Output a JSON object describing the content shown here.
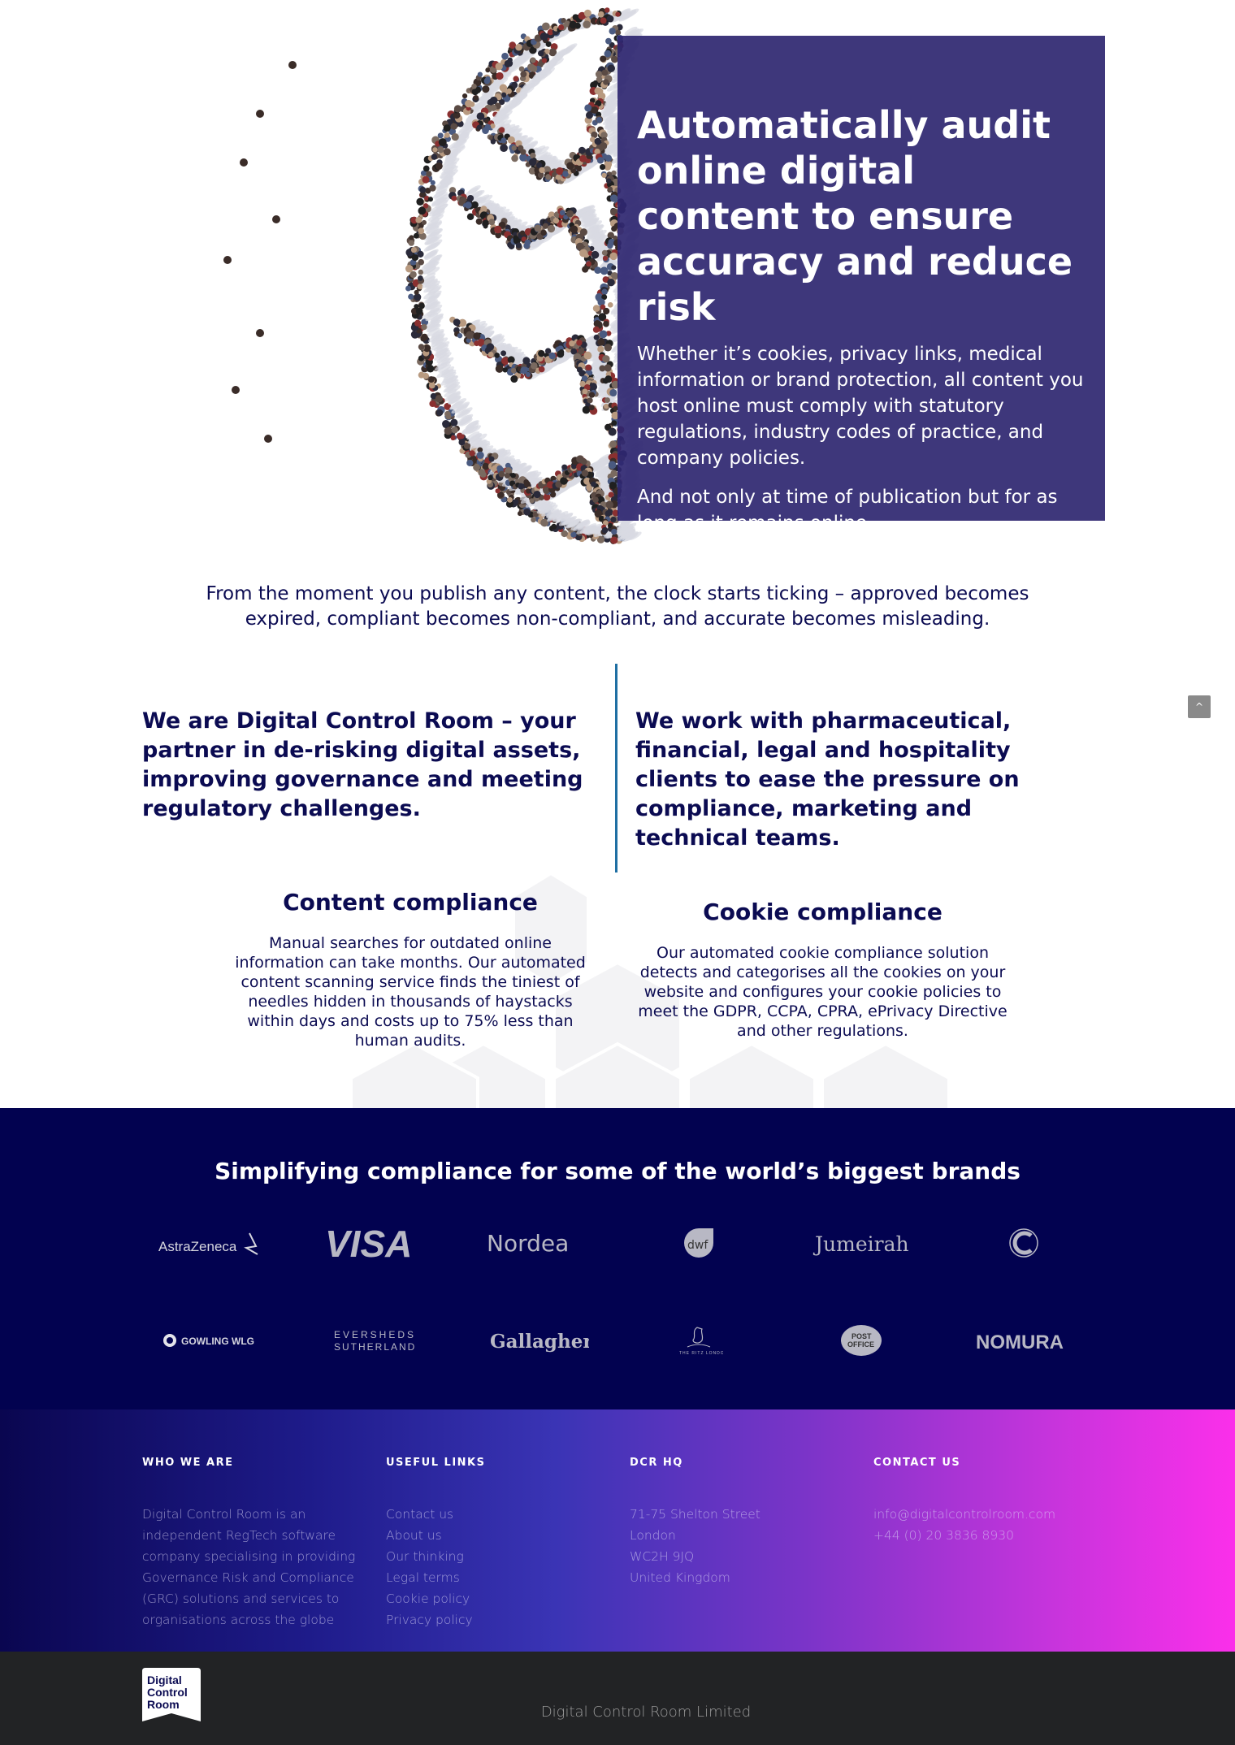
{
  "hero": {
    "title": "Automatically audit online digital content to ensure accuracy and reduce risk",
    "paragraph_1": "Whether it’s cookies, privacy links, medical information or brand protection, all content you host online must comply with statutory regulations, industry codes of practice, and company policies.",
    "paragraph_2": "And not only at time of publication but for as long as it remains online.",
    "image_alt": "Crowd of people forming a brain shape"
  },
  "intro": {
    "line_1": "From the moment you publish any content, the clock starts ticking – approved becomes",
    "line_2": "expired, compliant becomes non-compliant, and accurate becomes misleading."
  },
  "about": {
    "left": "We are Digital Control Room – your partner in de-risking digital assets, improving governance and meeting regulatory challenges.",
    "right": "We work with pharmaceutical, financial, legal and hospitality clients to ease the pressure on compliance, marketing and technical teams."
  },
  "back_to_top": {
    "icon": "chevron-up-icon",
    "glyph": "^"
  },
  "services": [
    {
      "title": "Content compliance",
      "body": "Manual searches for outdated online information can take months. Our automated content scanning service finds the tiniest of needles hidden in thousands of haystacks within days and costs up to 75% less than human audits."
    },
    {
      "title": "Cookie compliance",
      "body": "Our automated cookie compliance solution detects and categorises all the cookies on your website and configures your cookie policies to meet the GDPR, CCPA, CPRA, ePrivacy Directive and other regulations."
    }
  ],
  "brands": {
    "title": "Simplifying compliance for some of the world’s biggest brands",
    "logos": [
      "AstraZeneca",
      "VISA",
      "Nordea",
      "dwf",
      "Jumeirah",
      "Coutts",
      "GOWLING WLG",
      "EVERSHEDS SUTHERLAND",
      "Gallagher",
      "THE RITZ LONDON",
      "POST OFFICE",
      "NOMURA"
    ]
  },
  "footer": {
    "who_we_are": {
      "heading": "WHO WE ARE",
      "body": "Digital Control Room is an independent RegTech software company specialising in providing Governance Risk and Compliance (GRC) solutions and services to organisations across the globe"
    },
    "useful_links": {
      "heading": "USEFUL LINKS",
      "links": [
        "Contact us",
        "About us",
        "Our thinking",
        "Legal terms",
        "Cookie policy",
        "Privacy policy"
      ]
    },
    "hq": {
      "heading": "DCR HQ",
      "lines": [
        "71-75 Shelton Street",
        "London",
        "WC2H 9JQ",
        "United Kingdom"
      ]
    },
    "contact": {
      "heading": "CONTACT US",
      "email": "info@digitalcontrolroom.com",
      "phone": "+44 (0) 20 3836 8930"
    }
  },
  "bottom": {
    "logo_lines": [
      "Digital",
      "Control",
      "Room"
    ],
    "copyright": "Digital Control Room Limited"
  },
  "colors": {
    "hero_box": "#2e2670",
    "navy_text": "#0b0b52",
    "brands_bg": "#020250",
    "divider": "#1f6fa3",
    "gradient_start": "#0a0650",
    "gradient_end": "#fb2fea",
    "bottom_bar": "#222325"
  }
}
